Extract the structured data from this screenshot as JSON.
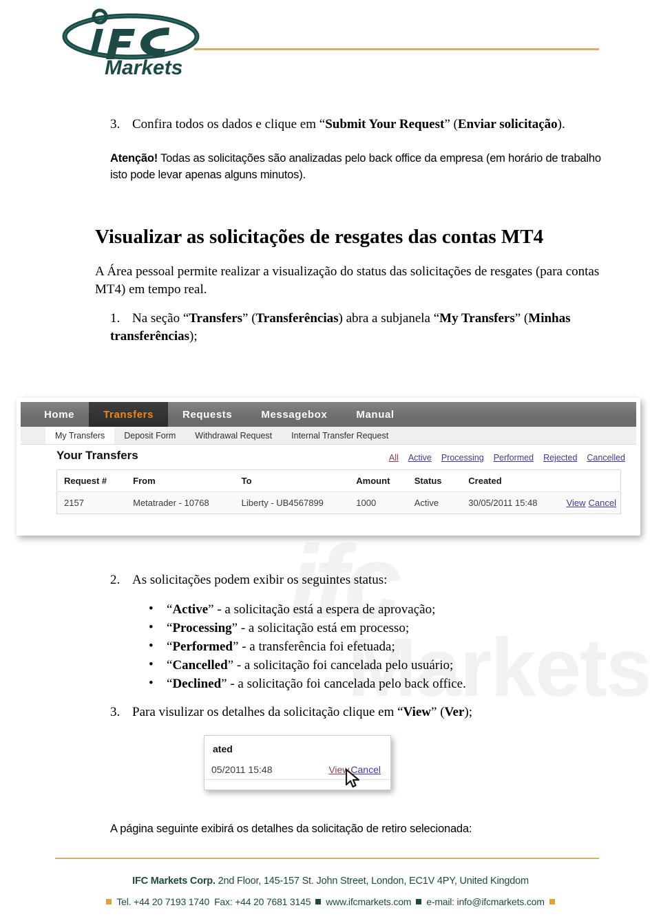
{
  "header": {
    "logo_primary": "ifc",
    "logo_secondary": "Markets",
    "rule_color": "#d6b15f"
  },
  "watermark": {
    "text_top": "ifc",
    "text_bottom": "Markets"
  },
  "steps": {
    "step3_top": {
      "number": "3.",
      "text_plain_1": "Confira todos os dados e clique em “",
      "text_bold_1": "Submit Your Request",
      "text_plain_2": "” (",
      "text_bold_2": "Enviar solicitação",
      "text_plain_3": ")."
    },
    "attention": {
      "label": "Atenção!",
      "text": " Todas as solicitações são analizadas pelo back office da empresa (em horário de trabalho isto pode levar apenas alguns minutos)."
    },
    "heading": "Visualizar as solicitações de resgates das contas MT4",
    "intro": "A Área pessoal permite realizar a visualização do status das solicitações de resgates (para contas MT4) em tempo real.",
    "step1": {
      "number": "1.",
      "plain_1": "Na seção “",
      "bold_1": "Transfers",
      "plain_2": "” (",
      "bold_2": "Transferências",
      "plain_3": ") abra a subjanela “",
      "bold_3": "My Transfers",
      "plain_4": "” (",
      "bold_4": "Minhas transferências",
      "plain_5": ");"
    },
    "step2": {
      "number": "2.",
      "text": "As solicitações podem exibir os seguintes status:"
    },
    "step3_bottom": {
      "number": "3.",
      "plain_1": "Para visulizar os detalhes da solicitação clique em “",
      "bold_1": "View",
      "plain_2": "” (",
      "bold_2": "Ver",
      "plain_3": ");"
    },
    "closing": "A página seguinte exibirá os detalhes da solicitação de retiro selecionada:"
  },
  "status_list": [
    {
      "term": "Active",
      "desc": " - a solicitação está a espera de aprovação;"
    },
    {
      "term": "Processing",
      "desc": " - a solicitação está em processo;"
    },
    {
      "term": "Performed",
      "desc": " - a transferência foi efetuada;"
    },
    {
      "term": "Cancelled",
      "desc": " - a solicitação foi cancelada pelo usuário;"
    },
    {
      "term": "Declined",
      "desc": " - a solicitação foi cancelada pelo back office."
    }
  ],
  "screenshot": {
    "nav": [
      {
        "label": "Home",
        "active": false
      },
      {
        "label": "Transfers",
        "active": true
      },
      {
        "label": "Requests",
        "active": false
      },
      {
        "label": "Messagebox",
        "active": false
      },
      {
        "label": "Manual",
        "active": false
      }
    ],
    "subnav": [
      {
        "label": "My Transfers",
        "active": true
      },
      {
        "label": "Deposit Form",
        "active": false
      },
      {
        "label": "Withdrawal Request",
        "active": false
      },
      {
        "label": "Internal Transfer Request",
        "active": false
      }
    ],
    "panel_title": "Your Transfers",
    "filters": [
      {
        "label": "All",
        "selected": true
      },
      {
        "label": "Active",
        "selected": false
      },
      {
        "label": "Processing",
        "selected": false
      },
      {
        "label": "Performed",
        "selected": false
      },
      {
        "label": "Rejected",
        "selected": false
      },
      {
        "label": "Cancelled",
        "selected": false
      }
    ],
    "table": {
      "columns": [
        "Request #",
        "From",
        "To",
        "Amount",
        "Status",
        "Created",
        ""
      ],
      "rows": [
        {
          "request": "2157",
          "from": "Metatrader - 10768",
          "to": "Liberty - UB4567899",
          "amount": "1000",
          "status": "Active",
          "created": "30/05/2011 15:48",
          "view": "View",
          "cancel": "Cancel"
        }
      ]
    },
    "active_tab_color": "#f0861a",
    "link_color": "#3b3b9c"
  },
  "screenshot_zoom": {
    "header_fragment": "ated",
    "date_fragment": "05/2011 15:48",
    "view": "View",
    "cancel": "Cancel"
  },
  "footer": {
    "company": "IFC Markets Corp.",
    "address": " 2nd Floor, 145-157 St. John Street, London, EC1V 4PY, United Kingdom",
    "tel": "Tel. +44 20 7193 1740",
    "fax": "Fax: +44 20 7681 3145",
    "web": "www.ifcmarkets.com",
    "email": "e-mail: info@ifcmarkets.com",
    "accent_gold": "#e0a338",
    "accent_teal": "#1d4a44"
  }
}
